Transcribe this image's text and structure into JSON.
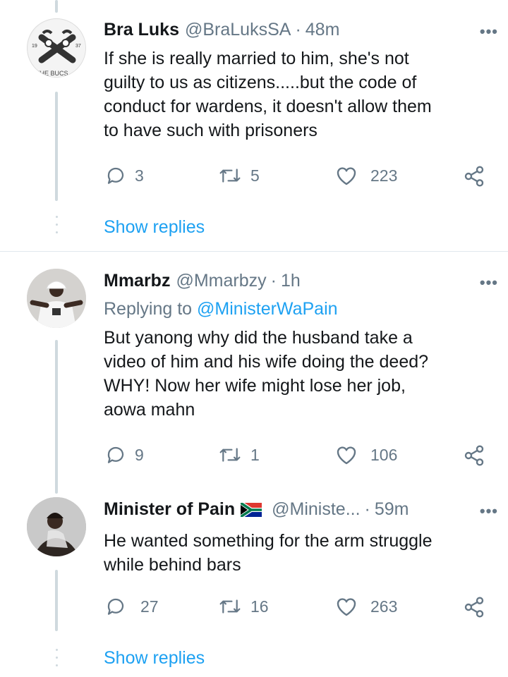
{
  "tweets": [
    {
      "display_name": "Bra Luks",
      "handle": "@BraLuksSA",
      "separator": "·",
      "time": "48m",
      "more_label": "•••",
      "text_lines": [
        "If she is really married to him, she's not",
        "guilty to us as citizens.....but the code of",
        "conduct for wardens, it doesn't allow them",
        "to have such with prisoners"
      ],
      "replies": "3",
      "retweets": "5",
      "likes": "223",
      "show_replies": "Show replies",
      "avatar_text": "THE BUCS",
      "avatar_num_left": "19",
      "avatar_num_right": "37"
    },
    {
      "display_name": "Mmarbz",
      "handle": "@Mmarbzy",
      "separator": "·",
      "time": "1h",
      "more_label": "•••",
      "replying_prefix": "Replying to",
      "replying_mention": "@MinisterWaPain",
      "text_lines": [
        "But yanong why did the husband take a",
        "video of him and his wife doing the deed?",
        "WHY! Now her wife might lose her job,",
        "aowa mahn"
      ],
      "replies": "9",
      "retweets": "1",
      "likes": "106"
    },
    {
      "display_name": "Minister of Pain",
      "handle": "@Ministe...",
      "separator": "·",
      "time": "59m",
      "more_label": "•••",
      "text_lines": [
        "He wanted something for the arm struggle",
        "while behind bars"
      ],
      "replies": "27",
      "retweets": "16",
      "likes": "263",
      "show_replies": "Show replies"
    }
  ],
  "colors": {
    "text": "#14171a",
    "secondary": "#657786",
    "accent": "#1da1f2",
    "thread_line": "#cfd9de",
    "divider": "#e1e8ed"
  },
  "icons": {
    "reply": "reply-icon",
    "retweet": "retweet-icon",
    "like": "heart-icon",
    "share": "share-icon",
    "more": "more-icon",
    "flag": "south-africa-flag-icon"
  }
}
